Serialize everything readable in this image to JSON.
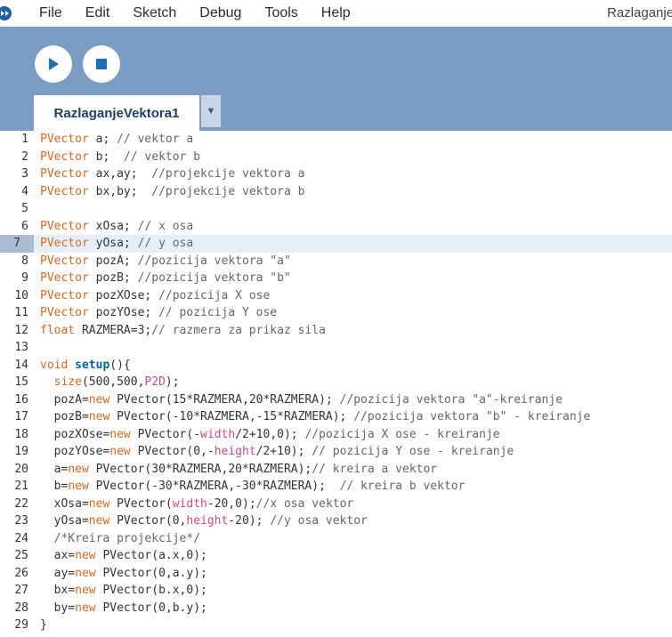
{
  "menu": [
    "File",
    "Edit",
    "Sketch",
    "Debug",
    "Tools",
    "Help"
  ],
  "window_title": "Razlaganje",
  "tab": {
    "label": "RazlaganjeVektora1",
    "menu_glyph": "▼"
  },
  "icons": {
    "run": "play-icon",
    "stop": "stop-icon",
    "logo": "processing-logo-icon"
  },
  "colors": {
    "toolbar": "#7b9cc3",
    "keyword": "#e2661a",
    "function": "#006699",
    "literal": "#d94a7a",
    "active_line": "#e4eff7"
  },
  "active_line": 7,
  "lines": [
    [
      [
        "k",
        "PVector"
      ],
      [
        "t",
        " a; "
      ],
      [
        "c",
        "// vektor a"
      ]
    ],
    [
      [
        "k",
        "PVector"
      ],
      [
        "t",
        " b;  "
      ],
      [
        "c",
        "// vektor b"
      ]
    ],
    [
      [
        "k",
        "PVector"
      ],
      [
        "t",
        " ax,ay;  "
      ],
      [
        "c",
        "//projekcije vektora a"
      ]
    ],
    [
      [
        "k",
        "PVector"
      ],
      [
        "t",
        " bx,by;  "
      ],
      [
        "c",
        "//projekcije vektora b"
      ]
    ],
    [],
    [
      [
        "k",
        "PVector"
      ],
      [
        "t",
        " xOsa; "
      ],
      [
        "c",
        "// x osa"
      ]
    ],
    [
      [
        "k",
        "PVector"
      ],
      [
        "t",
        " yOsa; "
      ],
      [
        "c",
        "// y osa"
      ]
    ],
    [
      [
        "k",
        "PVector"
      ],
      [
        "t",
        " pozA; "
      ],
      [
        "c",
        "//pozicija vektora \"a\""
      ]
    ],
    [
      [
        "k",
        "PVector"
      ],
      [
        "t",
        " pozB; "
      ],
      [
        "c",
        "//pozicija vektora \"b\""
      ]
    ],
    [
      [
        "k",
        "PVector"
      ],
      [
        "t",
        " pozXOse; "
      ],
      [
        "c",
        "//pozicija X ose"
      ]
    ],
    [
      [
        "k",
        "PVector"
      ],
      [
        "t",
        " pozYOse; "
      ],
      [
        "c",
        "// pozicija Y ose"
      ]
    ],
    [
      [
        "k",
        "float"
      ],
      [
        "t",
        " RAZMERA=3;"
      ],
      [
        "c",
        "// razmera za prikaz sila"
      ]
    ],
    [],
    [
      [
        "k",
        "void"
      ],
      [
        "t",
        " "
      ],
      [
        "f",
        "setup"
      ],
      [
        "t",
        "(){"
      ]
    ],
    [
      [
        "t",
        "  "
      ],
      [
        "k",
        "size"
      ],
      [
        "t",
        "(500,500,"
      ],
      [
        "l",
        "P2D"
      ],
      [
        "t",
        ");"
      ]
    ],
    [
      [
        "t",
        "  pozA="
      ],
      [
        "k",
        "new"
      ],
      [
        "t",
        " PVector(15*RAZMERA,20*RAZMERA); "
      ],
      [
        "c",
        "//pozicija vektora \"a\"-kreiranje"
      ]
    ],
    [
      [
        "t",
        "  pozB="
      ],
      [
        "k",
        "new"
      ],
      [
        "t",
        " PVector(-10*RAZMERA,-15*RAZMERA); "
      ],
      [
        "c",
        "//pozicija vektora \"b\" - kreiranje"
      ]
    ],
    [
      [
        "t",
        "  pozXOse="
      ],
      [
        "k",
        "new"
      ],
      [
        "t",
        " PVector(-"
      ],
      [
        "l",
        "width"
      ],
      [
        "t",
        "/2+10,0); "
      ],
      [
        "c",
        "//pozicija X ose - kreiranje"
      ]
    ],
    [
      [
        "t",
        "  pozYOse="
      ],
      [
        "k",
        "new"
      ],
      [
        "t",
        " PVector(0,-"
      ],
      [
        "l",
        "height"
      ],
      [
        "t",
        "/2+10); "
      ],
      [
        "c",
        "// pozicija Y ose - kreiranje"
      ]
    ],
    [
      [
        "t",
        "  a="
      ],
      [
        "k",
        "new"
      ],
      [
        "t",
        " PVector(30*RAZMERA,20*RAZMERA);"
      ],
      [
        "c",
        "// kreira a vektor"
      ]
    ],
    [
      [
        "t",
        "  b="
      ],
      [
        "k",
        "new"
      ],
      [
        "t",
        " PVector(-30*RAZMERA,-30*RAZMERA);  "
      ],
      [
        "c",
        "// kreira b vektor"
      ]
    ],
    [
      [
        "t",
        "  xOsa="
      ],
      [
        "k",
        "new"
      ],
      [
        "t",
        " PVector("
      ],
      [
        "l",
        "width"
      ],
      [
        "t",
        "-20,0);"
      ],
      [
        "c",
        "//x osa vektor"
      ]
    ],
    [
      [
        "t",
        "  yOsa="
      ],
      [
        "k",
        "new"
      ],
      [
        "t",
        " PVector(0,"
      ],
      [
        "l",
        "height"
      ],
      [
        "t",
        "-20); "
      ],
      [
        "c",
        "//y osa vektor"
      ]
    ],
    [
      [
        "t",
        "  "
      ],
      [
        "c",
        "/*Kreira projekcije*/"
      ]
    ],
    [
      [
        "t",
        "  ax="
      ],
      [
        "k",
        "new"
      ],
      [
        "t",
        " PVector(a.x,0);"
      ]
    ],
    [
      [
        "t",
        "  ay="
      ],
      [
        "k",
        "new"
      ],
      [
        "t",
        " PVector(0,a.y);"
      ]
    ],
    [
      [
        "t",
        "  bx="
      ],
      [
        "k",
        "new"
      ],
      [
        "t",
        " PVector(b.x,0);"
      ]
    ],
    [
      [
        "t",
        "  by="
      ],
      [
        "k",
        "new"
      ],
      [
        "t",
        " PVector(0,b.y);"
      ]
    ],
    [
      [
        "t",
        "}"
      ]
    ]
  ]
}
